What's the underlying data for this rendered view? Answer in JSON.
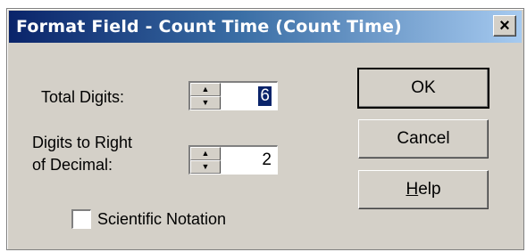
{
  "window": {
    "title": "Format Field - Count Time (Count Time)",
    "close_label": "×"
  },
  "fields": {
    "total_digits": {
      "label": "Total Digits:",
      "value": "6"
    },
    "decimal_digits": {
      "label_line1": "Digits to Right",
      "label_line2": "of Decimal:",
      "value": "2"
    }
  },
  "scientific_notation": {
    "label": "Scientific Notation",
    "checked": false
  },
  "buttons": {
    "ok": "OK",
    "cancel": "Cancel",
    "help_accel": "H",
    "help_rest": "elp"
  },
  "icons": {
    "spin_up": "▲",
    "spin_down": "▼"
  },
  "colors": {
    "dialog_bg": "#d4d0c8",
    "titlebar_start": "#0a246a",
    "titlebar_end": "#a6caf0",
    "selection": "#0a246a"
  }
}
